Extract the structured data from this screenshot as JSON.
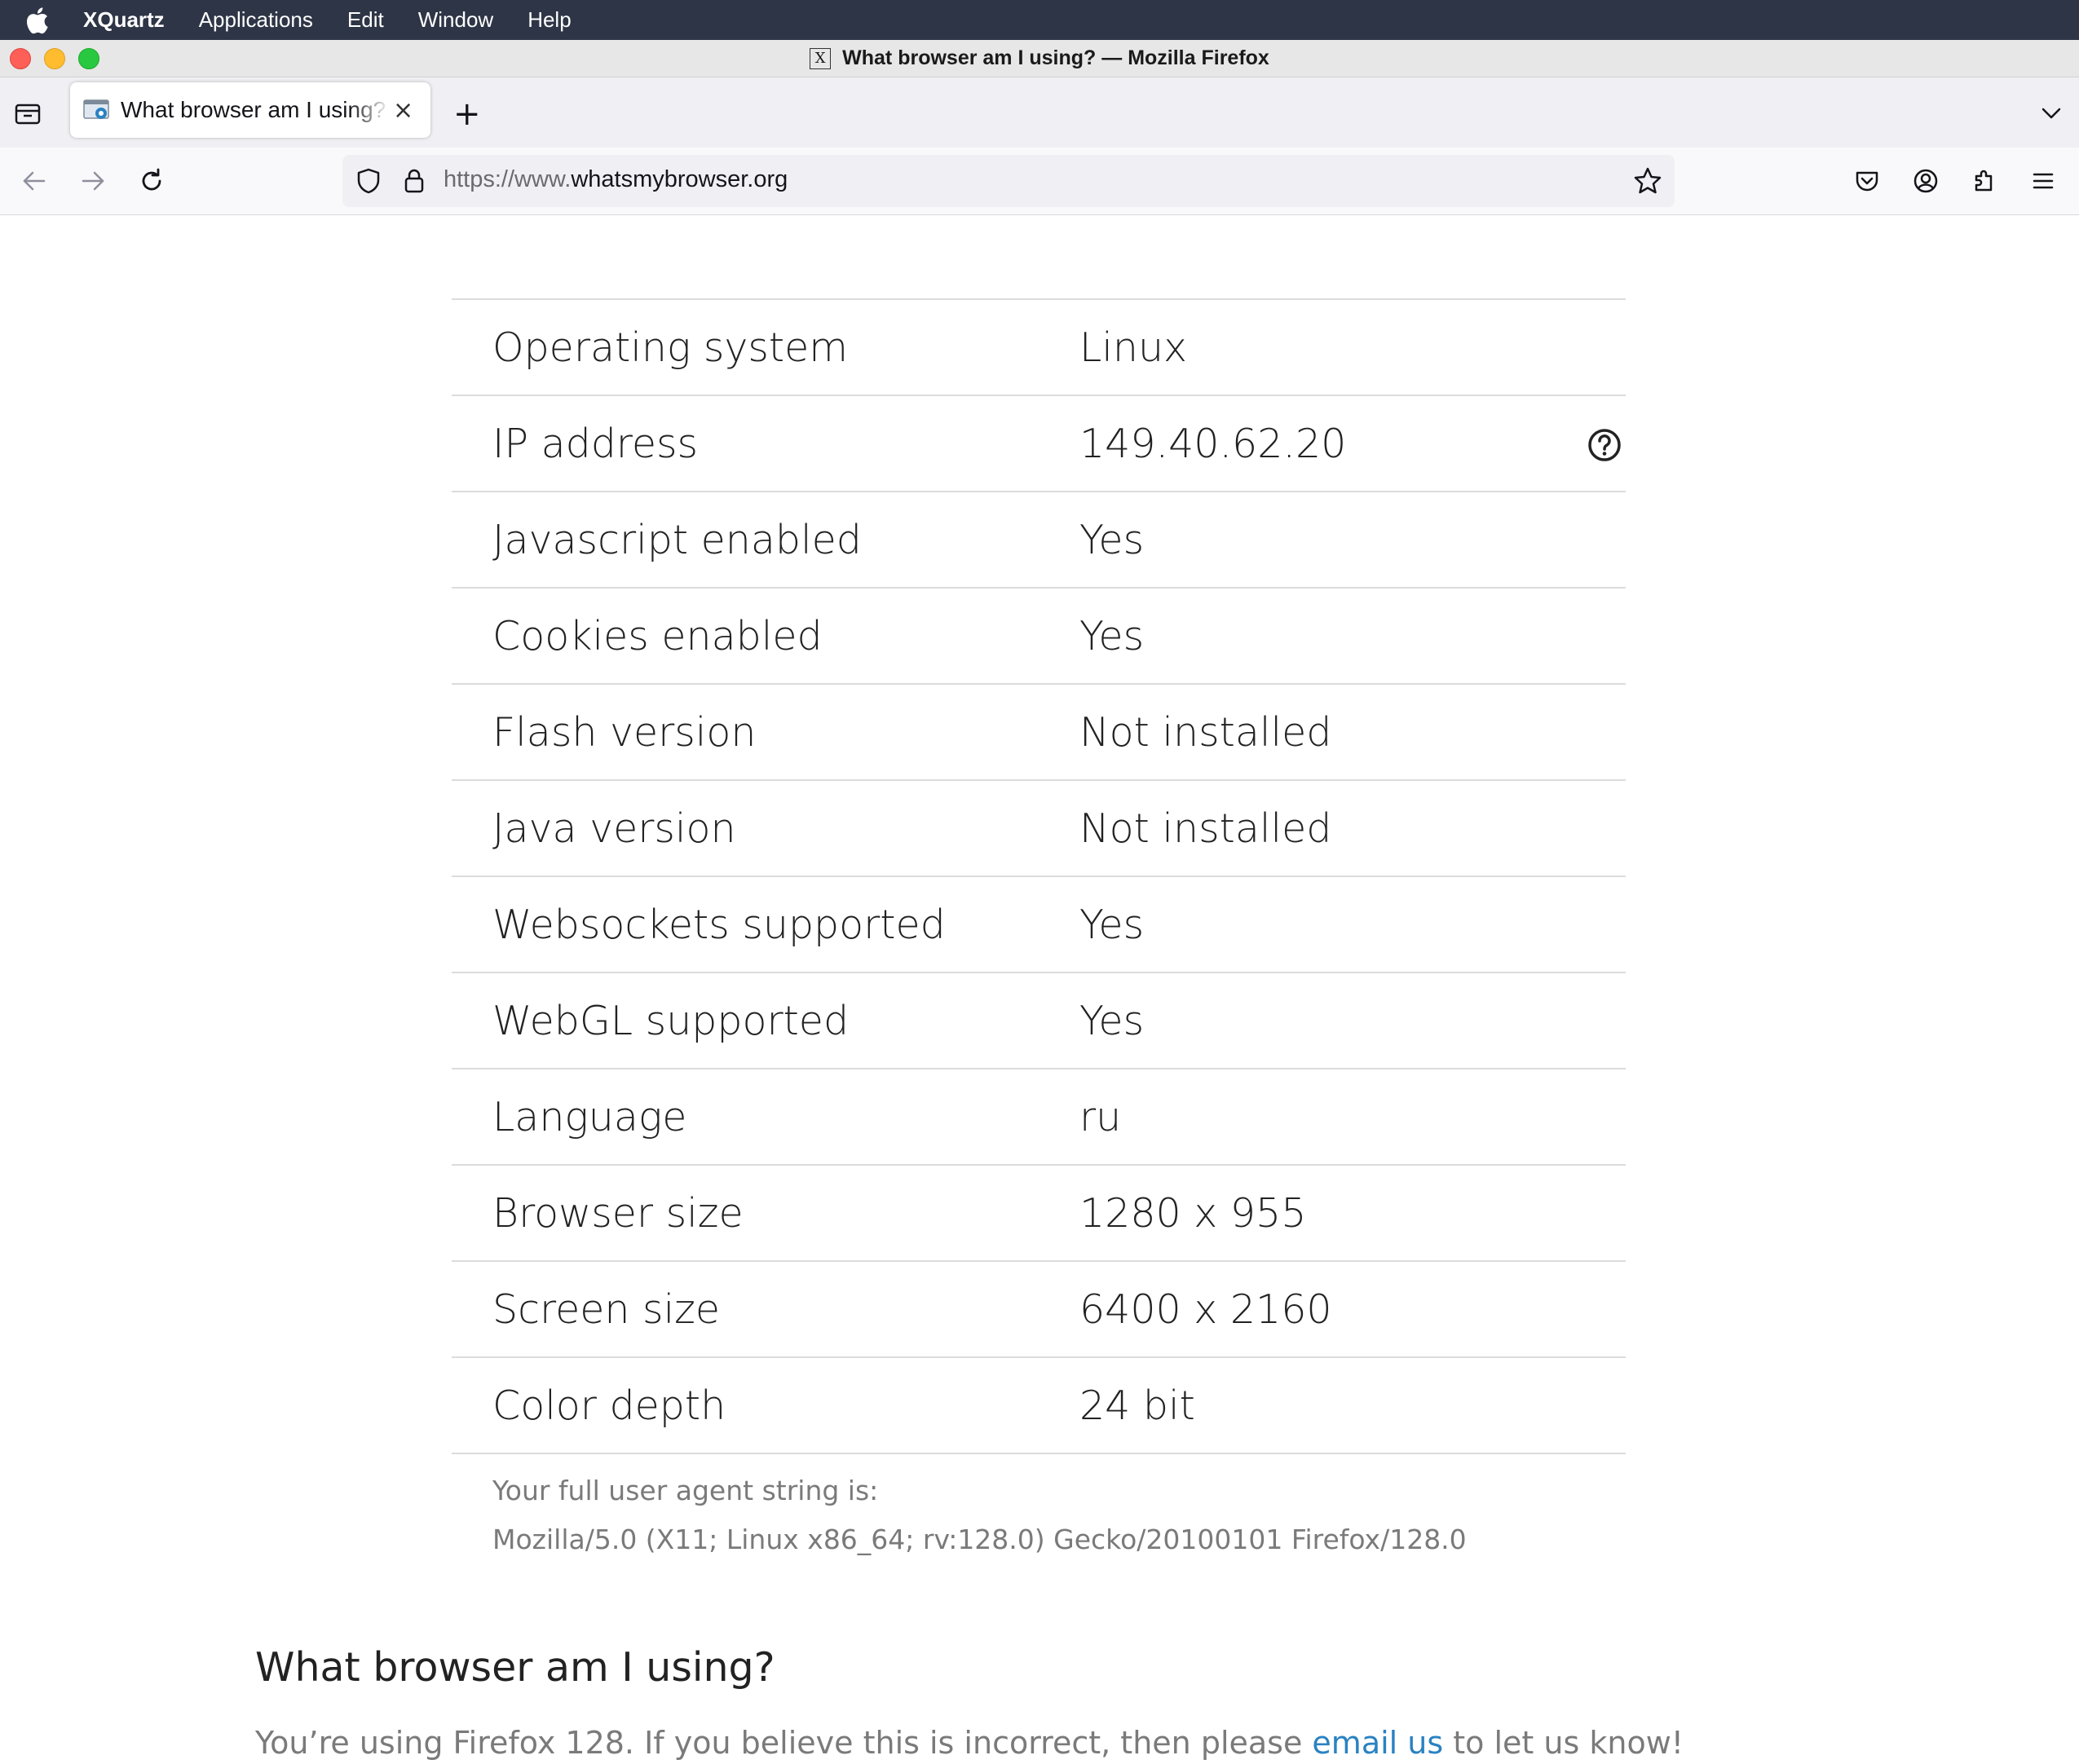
{
  "menubar": {
    "app": "XQuartz",
    "items": [
      "Applications",
      "Edit",
      "Window",
      "Help"
    ]
  },
  "window": {
    "title": "What browser am I using? — Mozilla Firefox"
  },
  "tab": {
    "title": "What browser am I using?",
    "close_glyph": "×",
    "new_tab_glyph": "+"
  },
  "urlbar": {
    "prefix": "https://www.",
    "domain": "whatsmybrowser.org"
  },
  "info_rows": [
    {
      "key": "Operating system",
      "value": "Linux"
    },
    {
      "key": "IP address",
      "value": "149.40.62.20"
    },
    {
      "key": "Javascript enabled",
      "value": "Yes"
    },
    {
      "key": "Cookies enabled",
      "value": "Yes"
    },
    {
      "key": "Flash version",
      "value": "Not installed"
    },
    {
      "key": "Java version",
      "value": "Not installed"
    },
    {
      "key": "Websockets supported",
      "value": "Yes"
    },
    {
      "key": "WebGL supported",
      "value": "Yes"
    },
    {
      "key": "Language",
      "value": "ru"
    },
    {
      "key": "Browser size",
      "value": "1280 x 955"
    },
    {
      "key": "Screen size",
      "value": "6400 x 2160"
    },
    {
      "key": "Color depth",
      "value": "24 bit"
    }
  ],
  "user_agent": {
    "label": "Your full user agent string is:",
    "value": "Mozilla/5.0 (X11; Linux x86_64; rv:128.0) Gecko/20100101 Firefox/128.0"
  },
  "section": {
    "heading": "What browser am I using?",
    "text_before": "You’re using Firefox 128. If you believe this is incorrect, then please ",
    "link": "email us",
    "text_after": " to let us know!"
  },
  "colors": {
    "menubar_bg": "#2e3546",
    "link": "#2a82c2",
    "divider": "#dcdcdc"
  }
}
